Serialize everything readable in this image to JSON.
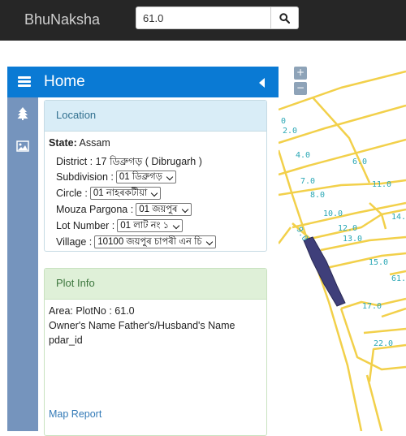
{
  "header": {
    "brand": "BhuNaksha",
    "search_value": "61.0"
  },
  "map": {
    "zoom_in": "+",
    "zoom_out": "−",
    "plot_labels": [
      "0",
      "2.0",
      "4.0",
      "6.0",
      "7.0",
      "8.0",
      "11.0",
      "10.0",
      "12.0",
      "13.0",
      "14.",
      "9.0",
      "15.0",
      "17.0",
      "22.0",
      "61."
    ],
    "selected_plot_color": "#3f3f7a",
    "boundary_color": "#f2d04a",
    "label_color": "#2aa7b5"
  },
  "panel": {
    "title": "Home",
    "header_color": "#0a7ad4",
    "rail_color": "#7594bd"
  },
  "location": {
    "heading": "Location",
    "state_label": "State:",
    "state_value": "Assam",
    "district": "District : 17 ডিব্ৰুগড় ( Dibrugarh )",
    "subdivision_label": "Subdivision :",
    "subdivision_value": "01 ডিব্ৰুগড়",
    "circle_label": "Circle :",
    "circle_value": "01 নাহৰকটীয়া",
    "mouza_label": "Mouza Pargona :",
    "mouza_value": "01 জয়পুৰ",
    "lot_label": "Lot Number :",
    "lot_value": "01 লাট নং ১",
    "village_label": "Village :",
    "village_value": "10100 জয়পুৰ চাপৰী এন চি"
  },
  "plot_info": {
    "heading": "Plot Info",
    "area_line": "Area: PlotNo : 61.0",
    "owner_line": "Owner's Name Father's/Husband's Name",
    "pdar_line": "pdar_id",
    "map_report": "Map Report"
  }
}
